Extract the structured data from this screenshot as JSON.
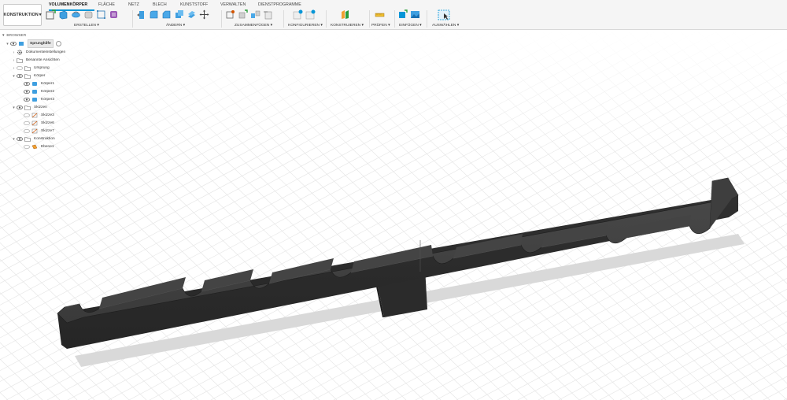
{
  "workspace": {
    "label": "KONSTRUKTION"
  },
  "tabs": [
    {
      "label": "VOLUMENKÖRPER",
      "active": true
    },
    {
      "label": "FLÄCHE"
    },
    {
      "label": "NETZ"
    },
    {
      "label": "BLECH"
    },
    {
      "label": "KUNSTSTOFF"
    },
    {
      "label": "VERWALTEN"
    },
    {
      "label": "DIENSTPROGRAMME"
    }
  ],
  "groups": {
    "erstellen": "ERSTELLEN",
    "aendern": "ÄNDERN",
    "zusammenfuegen": "ZUSAMMENFÜGEN",
    "konfigurieren": "KONFIGURIEREN",
    "konstruieren": "KONSTRUIEREN",
    "pruefen": "PRÜFEN",
    "einfuegen": "EINFÜGEN",
    "auswaehlen": "AUSWÄHLEN"
  },
  "browser": {
    "title": "BROWSER",
    "root": "Sprunghilfe",
    "items": {
      "dokument": "Dokumenteinstellungen",
      "ansichten": "Benannte Ansichten",
      "ursprung": "Ursprung",
      "koerper": "Körper",
      "koerper1": "Körper1",
      "koerper2": "Körper2",
      "koerper3": "Körper3",
      "skizzen": "Skizzen",
      "skizze3": "Skizze3",
      "skizze6": "Skizze6",
      "skizze7": "Skizze7",
      "konstruktion": "Konstruktion",
      "ebene1": "Ebene1"
    }
  },
  "colors": {
    "accent": "#0696d7",
    "body": "#3a3a3a",
    "grid": "#e4e4e4",
    "shadow": "#d6d6d6"
  }
}
